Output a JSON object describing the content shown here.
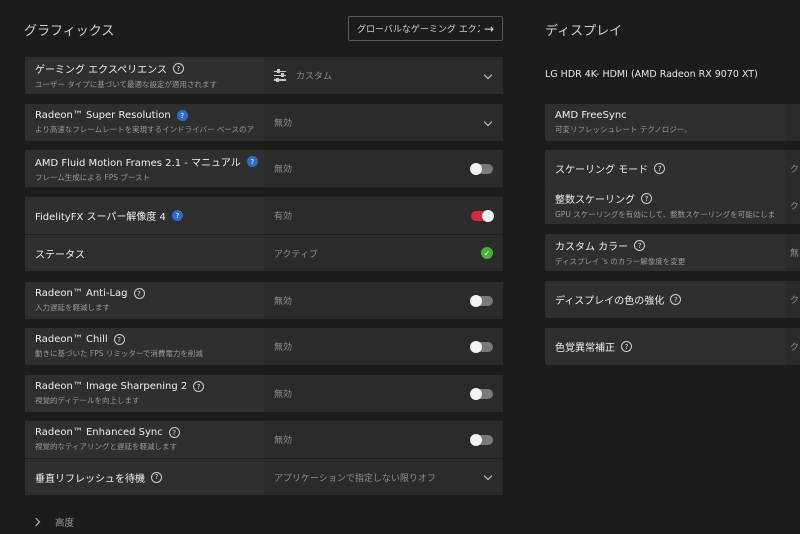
{
  "graphics": {
    "title": "グラフィックス",
    "global_button": "グローバルなゲーミング エクスペ...",
    "gaming_experience": {
      "title": "ゲーミング エクスペリエンス",
      "subtitle": "ユーザー タイプに基づいて最適な設定が適用されます",
      "value": "カスタム"
    },
    "rsr": {
      "title": "Radeon™ Super Resolution",
      "subtitle": "より高速なフレームレートを実現するインドライバー ベースのアップスケール...",
      "value": "無効"
    },
    "afmf": {
      "title": "AMD Fluid Motion Frames 2.1 - マニュアル",
      "subtitle": "フレーム生成による FPS ブースト",
      "value": "無効",
      "enabled": false
    },
    "fsr": {
      "title": "FidelityFX スーパー解像度 4",
      "value": "有効",
      "enabled": true,
      "status_label": "ステータス",
      "status_value": "アクティブ"
    },
    "antilag": {
      "title": "Radeon™ Anti-Lag",
      "subtitle": "入力遅延を軽減します",
      "value": "無効",
      "enabled": false
    },
    "chill": {
      "title": "Radeon™ Chill",
      "subtitle": "動きに基づいた FPS リミッターで消費電力を削減",
      "value": "無効",
      "enabled": false
    },
    "sharpening": {
      "title": "Radeon™ Image Sharpening 2",
      "subtitle": "視覚的ディテールを向上します",
      "value": "無効",
      "enabled": false
    },
    "enhanced_sync": {
      "title": "Radeon™ Enhanced Sync",
      "subtitle": "視覚的なティアリングと遅延を軽減します",
      "value": "無効",
      "enabled": false
    },
    "vsync": {
      "title": "垂直リフレッシュを待機",
      "value": "アプリケーションで指定しない限りオフ"
    },
    "advanced_label": "高度"
  },
  "display": {
    "title": "ディスプレイ",
    "monitor_name": "LG HDR 4K- HDMI (AMD Radeon RX 9070 XT)",
    "freesync": {
      "title": "AMD FreeSync",
      "subtitle": "可変リフレッシュレート テクノロジー。"
    },
    "scaling_mode": {
      "title": "スケーリング モード",
      "value_clip": "ク"
    },
    "integer_scaling": {
      "title": "整数スケーリング",
      "subtitle": "GPU スケーリングを有効にして、整数スケーリングを可能にします。",
      "value_clip": "ク"
    },
    "custom_color": {
      "title": "カスタム カラー",
      "subtitle": "ディスプレイ 's のカラー解像度を変更",
      "value_clip": "無"
    },
    "color_enhance": {
      "title": "ディスプレイの色の強化",
      "value_clip": "ク"
    },
    "color_deficiency": {
      "title": "色覚異常補正",
      "value_clip": "ク"
    }
  }
}
